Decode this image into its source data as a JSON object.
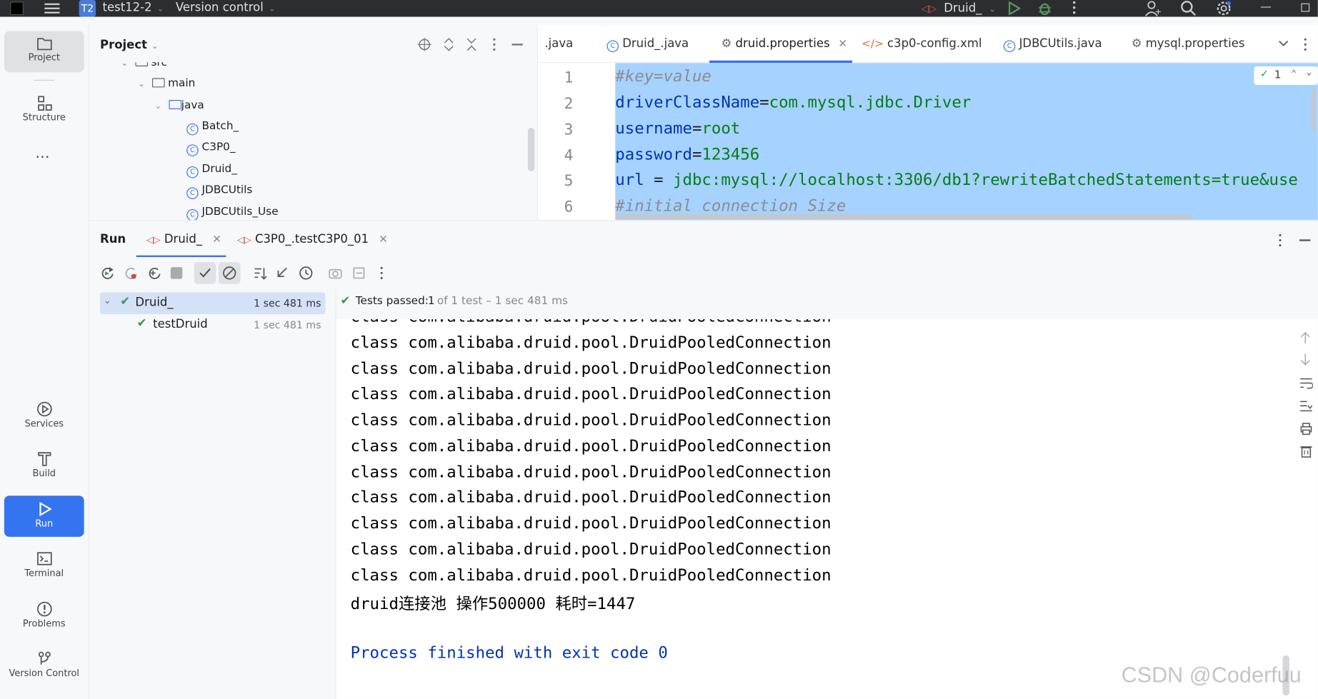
{
  "title_bar": {
    "project_badge": "T2",
    "project_name": "test12-2",
    "vcs_menu": "Version control",
    "run_config": "Druid_"
  },
  "sidebar": {
    "top_items": [
      {
        "label": "Project",
        "icon": "folder-icon"
      },
      {
        "label": "Structure",
        "icon": "structure-icon"
      }
    ],
    "more": "...",
    "bottom_items": [
      {
        "label": "Services",
        "icon": "services-icon"
      },
      {
        "label": "Build",
        "icon": "build-icon"
      },
      {
        "label": "Run",
        "icon": "run-icon"
      },
      {
        "label": "Terminal",
        "icon": "terminal-icon"
      },
      {
        "label": "Problems",
        "icon": "problems-icon"
      },
      {
        "label": "Version Control",
        "icon": "version-control-icon"
      }
    ]
  },
  "project_panel": {
    "title": "Project",
    "tree": [
      {
        "label": "src",
        "type": "folder",
        "level": 1
      },
      {
        "label": "main",
        "type": "folder",
        "level": 2
      },
      {
        "label": "java",
        "type": "folder-blue",
        "level": 3
      },
      {
        "label": "Batch_",
        "type": "class",
        "level": 4
      },
      {
        "label": "C3P0_",
        "type": "class",
        "level": 4
      },
      {
        "label": "Druid_",
        "type": "class",
        "level": 4
      },
      {
        "label": "JDBCUtils",
        "type": "class",
        "level": 4
      },
      {
        "label": "JDBCUtils_Use",
        "type": "class",
        "level": 4
      }
    ]
  },
  "editor": {
    "tabs": [
      {
        "label": ".java",
        "icon": "none"
      },
      {
        "label": "Druid_.java",
        "icon": "class"
      },
      {
        "label": "druid.properties",
        "icon": "gear",
        "active": true
      },
      {
        "label": "c3p0-config.xml",
        "icon": "xml"
      },
      {
        "label": "JDBCUtils.java",
        "icon": "class"
      },
      {
        "label": "mysql.properties",
        "icon": "gear"
      }
    ],
    "inspection_count": "1",
    "lines": [
      {
        "num": "1",
        "comment": "#key=value"
      },
      {
        "num": "2",
        "key": "driverClassName",
        "sep": "=",
        "value": "com.mysql.jdbc.Driver"
      },
      {
        "num": "3",
        "key": "username",
        "sep": "=",
        "value": "root"
      },
      {
        "num": "4",
        "key": "password",
        "sep": "=",
        "value": "123456"
      },
      {
        "num": "5",
        "key": "url",
        "sep": " = ",
        "value": "jdbc:mysql://localhost:3306/db1?rewriteBatchedStatements=true&use"
      },
      {
        "num": "6",
        "comment": "#initial connection Size"
      }
    ]
  },
  "run_panel": {
    "title": "Run",
    "tabs": [
      {
        "label": "Druid_",
        "active": true
      },
      {
        "label": "C3P0_.testC3P0_01",
        "active": false
      }
    ],
    "test_tree": [
      {
        "label": "Druid_",
        "time": "1 sec 481 ms",
        "level": 0
      },
      {
        "label": "testDruid",
        "time": "1 sec 481 ms",
        "level": 1
      }
    ],
    "status": {
      "prefix": "Tests passed:",
      "count": "1",
      "suffix": "of 1 test – 1 sec 481 ms"
    },
    "console_lines": [
      "class com.alibaba.druid.pool.DruidPooledConnection",
      "class com.alibaba.druid.pool.DruidPooledConnection",
      "class com.alibaba.druid.pool.DruidPooledConnection",
      "class com.alibaba.druid.pool.DruidPooledConnection",
      "class com.alibaba.druid.pool.DruidPooledConnection",
      "class com.alibaba.druid.pool.DruidPooledConnection",
      "class com.alibaba.druid.pool.DruidPooledConnection",
      "class com.alibaba.druid.pool.DruidPooledConnection",
      "class com.alibaba.druid.pool.DruidPooledConnection",
      "class com.alibaba.druid.pool.DruidPooledConnection",
      "class com.alibaba.druid.pool.DruidPooledConnection",
      "druid连接池 操作500000 耗时=1447"
    ],
    "exit_message": "Process finished with exit code 0"
  },
  "watermark": "CSDN @Coderfuu",
  "colors": {
    "accent": "#3574f0",
    "selection": "#a6d2ff",
    "test_pass": "#369650",
    "keyword": "#0033b3",
    "string": "#067d17"
  }
}
